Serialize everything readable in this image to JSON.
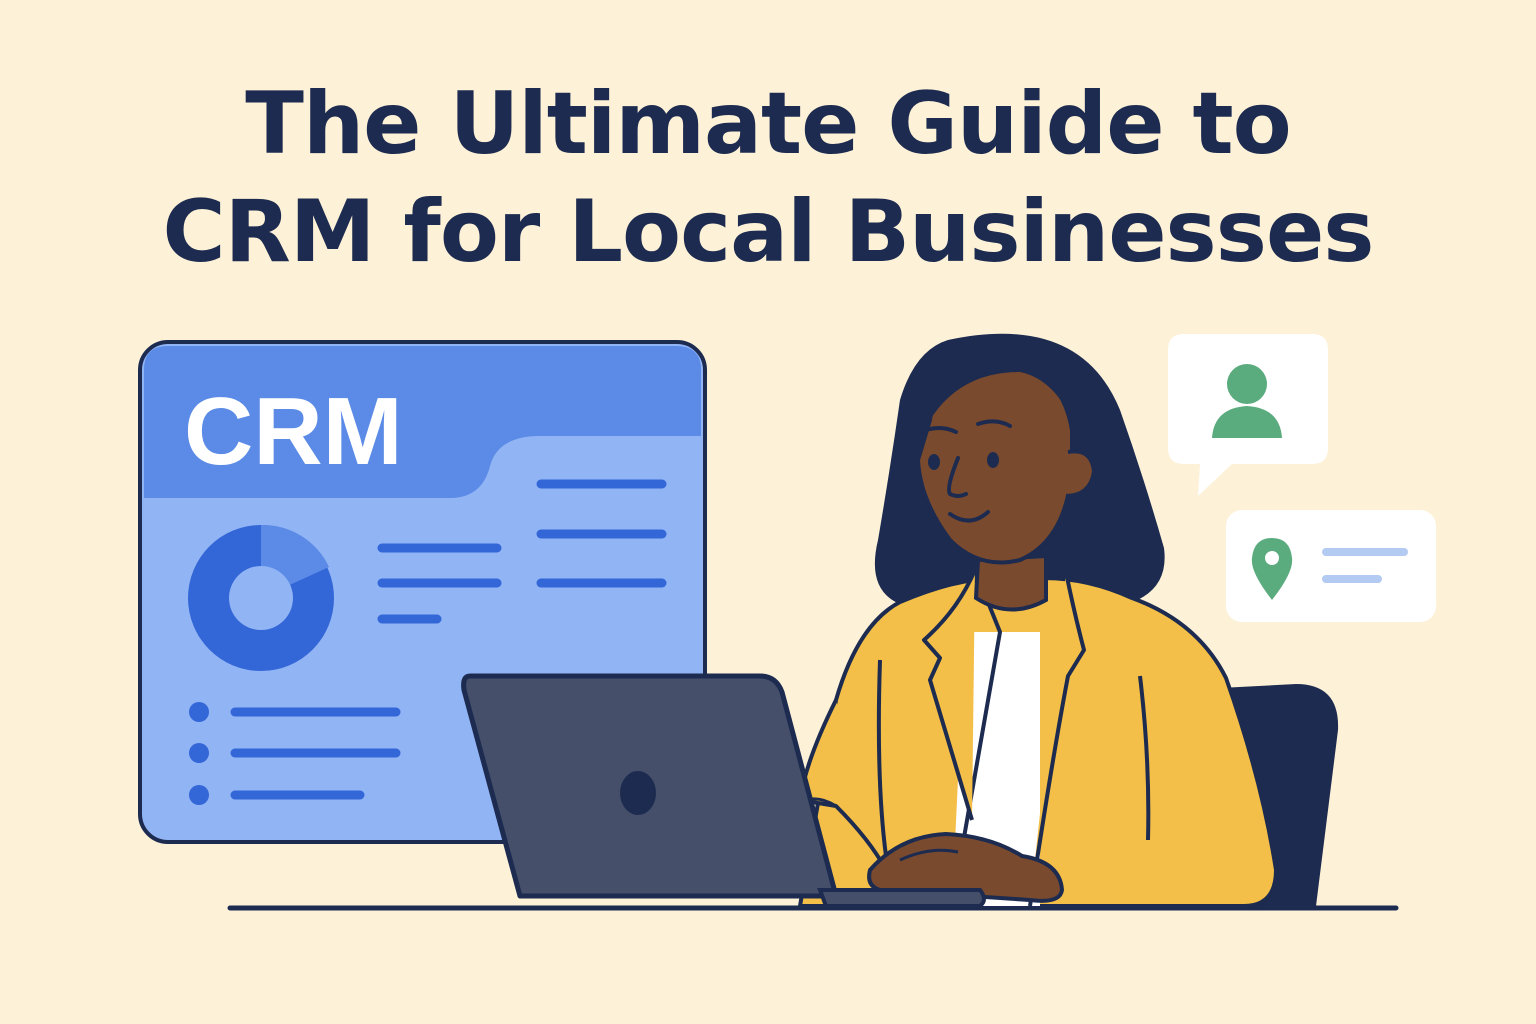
{
  "headline": {
    "line1": "The Ultimate Guide to",
    "line2": "CRM for Local Businesses"
  },
  "dashboard": {
    "label": "CRM",
    "donut_percent_highlight": 0.17
  },
  "icons": {
    "contact_bubble": "user-icon",
    "location_card": "map-pin-icon",
    "laptop_logo": "apple-like-logo-icon"
  },
  "colors": {
    "background": "#fdf1d8",
    "navy": "#1c2b4f",
    "panel_blue": "#5b8be6",
    "panel_light": "#91b4f5",
    "accent_blue": "#3366d6",
    "jacket_yellow": "#f3bf48",
    "skin": "#7a4a2e",
    "green": "#5aab7d"
  }
}
